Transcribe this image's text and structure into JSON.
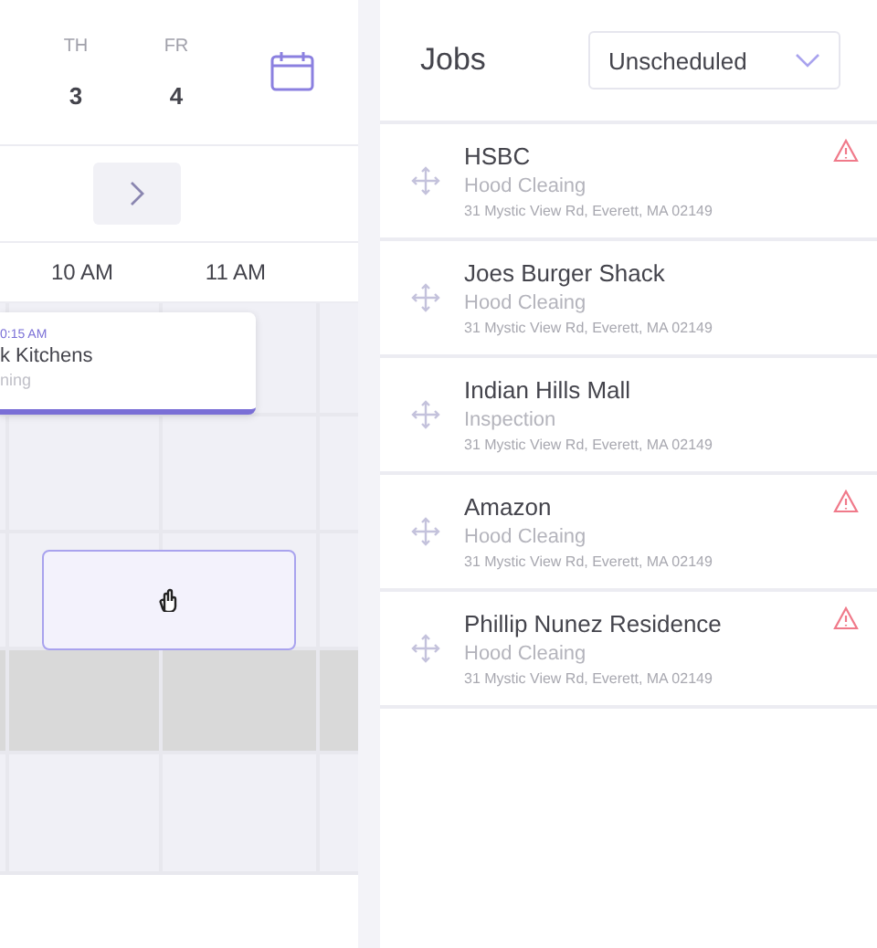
{
  "calendar": {
    "days": [
      {
        "weekday": "TH",
        "date": "3"
      },
      {
        "weekday": "FR",
        "date": "4"
      }
    ],
    "times": [
      "10 AM",
      "11 AM"
    ],
    "grid_rows": [
      {
        "kind": "open"
      },
      {
        "kind": "open"
      },
      {
        "kind": "open"
      },
      {
        "kind": "blocked"
      },
      {
        "kind": "open"
      }
    ],
    "event": {
      "time": "0:15 AM",
      "title": "k Kitchens",
      "type": "ning"
    }
  },
  "jobs": {
    "title": "Jobs",
    "filter": "Unscheduled",
    "items": [
      {
        "name": "HSBC",
        "service": "Hood Cleaing",
        "address": "31 Mystic View Rd, Everett, MA 02149",
        "warning": true
      },
      {
        "name": "Joes Burger Shack",
        "service": "Hood Cleaing",
        "address": "31 Mystic View Rd, Everett, MA 02149",
        "warning": false
      },
      {
        "name": "Indian Hills Mall",
        "service": "Inspection",
        "address": "31 Mystic View Rd, Everett, MA 02149",
        "warning": false
      },
      {
        "name": "Amazon",
        "service": "Hood Cleaing",
        "address": "31 Mystic View Rd, Everett, MA 02149",
        "warning": true
      },
      {
        "name": "Phillip Nunez Residence",
        "service": "Hood Cleaing",
        "address": "31 Mystic View Rd, Everett, MA 02149",
        "warning": true
      }
    ]
  }
}
